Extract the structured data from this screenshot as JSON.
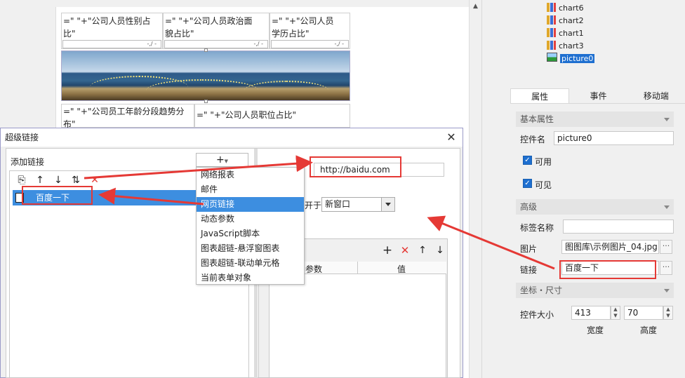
{
  "canvas": {
    "cells": [
      {
        "line1": "=\"      \"+\"公司人员性别占",
        "line2": "比\""
      },
      {
        "line1": "=\"      \"+\"公司人员政治面",
        "line2": "貌占比\""
      },
      {
        "line1": "=\"      \"+\"公司人员",
        "line2": "学历占比\""
      }
    ],
    "mini_select": "-,/ -",
    "cells2": [
      {
        "line1": "=\"      \"+\"公司员工年龄分段趋势分",
        "line2": "布\""
      },
      {
        "line1": "=\"      \"+\"公司人员职位占比\"",
        "line2": ""
      }
    ],
    "scroll_up": "▲"
  },
  "tree": {
    "items": [
      {
        "label": "chart6",
        "icon": "chart-icon"
      },
      {
        "label": "chart2",
        "icon": "chart-icon"
      },
      {
        "label": "chart1",
        "icon": "chart-icon"
      },
      {
        "label": "chart3",
        "icon": "chart-icon"
      },
      {
        "label": "picture0",
        "icon": "picture-icon"
      }
    ]
  },
  "props": {
    "tabs": [
      "属性",
      "事件",
      "移动端"
    ],
    "basic_section": "基本属性",
    "control_name_label": "控件名",
    "control_name_value": "picture0",
    "enabled_label": "可用",
    "visible_label": "可见",
    "advanced_section": "高级",
    "tag_name_label": "标签名称",
    "tag_name_value": "",
    "picture_label": "图片",
    "picture_value": "图图库\\示例图片_04.jpg",
    "link_label": "链接",
    "link_value": "百度一下",
    "dots": "···",
    "coord_section": "坐标・尺寸",
    "size_label": "控件大小",
    "width_value": "413",
    "height_value": "70",
    "width_label": "宽度",
    "height_label": "高度"
  },
  "dialog": {
    "title": "超级链接",
    "close": "✕",
    "add_link_label": "添加链接",
    "toolbar": {
      "copy": "⎘",
      "up": "↑",
      "down": "↓",
      "move": "⇅",
      "delete": "✕"
    },
    "links": [
      "百度一下"
    ],
    "add_button": "+",
    "menu": [
      "网络报表",
      "邮件",
      "网页链接",
      "动态参数",
      "JavaScript脚本",
      "图表超链-悬浮窗图表",
      "图表超链-联动单元格",
      "当前表单对象"
    ],
    "menu_selected": "网页链接",
    "url": "http://baidu.com",
    "open_in_label": "开于",
    "open_in_value": "新窗口",
    "param_toolbar": {
      "add": "+",
      "delete": "✕",
      "up": "↑",
      "down": "↓"
    },
    "param_columns": [
      "参数",
      "值"
    ]
  },
  "colors": {
    "highlight": "#3d8ee0",
    "annotation": "#e53935",
    "selected_tree": "#1e6fd0"
  }
}
